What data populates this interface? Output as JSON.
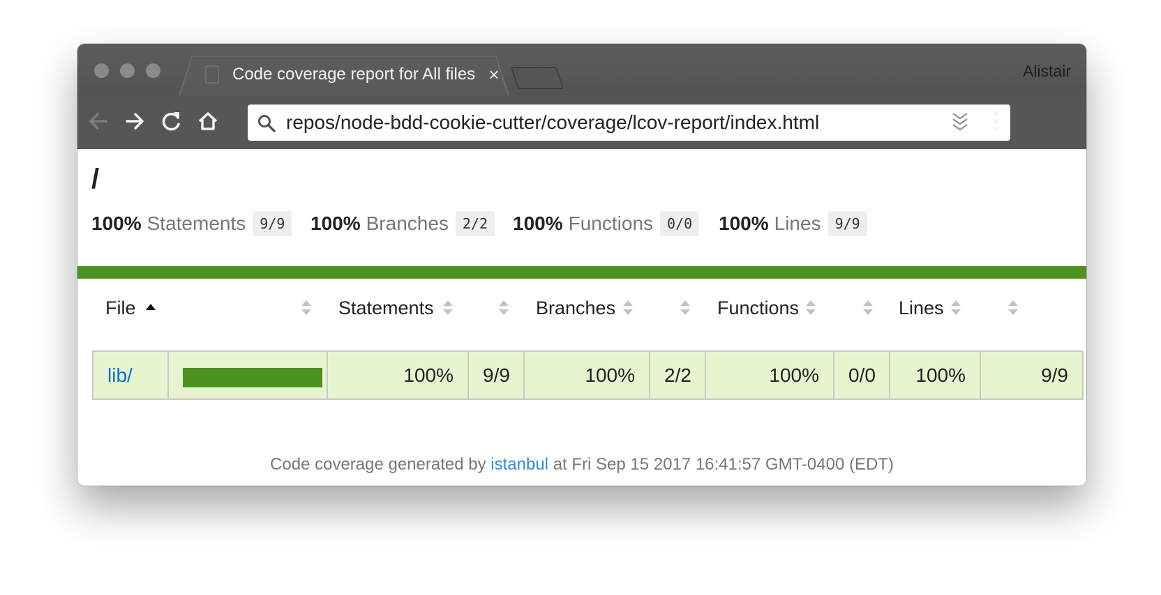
{
  "browser": {
    "tab_title": "Code coverage report for All files",
    "tab_close": "×",
    "profile_name": "Alistair",
    "url": "repos/node-bdd-cookie-cutter/coverage/lcov-report/index.html",
    "icons": {
      "back": "back-arrow-icon",
      "forward": "forward-arrow-icon",
      "reload": "reload-icon",
      "home": "home-icon",
      "search": "search-icon",
      "extension": "chevrons-down-icon",
      "menu": "kebab-menu-icon"
    }
  },
  "report": {
    "breadcrumb": "/",
    "summary": [
      {
        "pct": "100%",
        "label": "Statements",
        "fraction": "9/9"
      },
      {
        "pct": "100%",
        "label": "Branches",
        "fraction": "2/2"
      },
      {
        "pct": "100%",
        "label": "Functions",
        "fraction": "0/0"
      },
      {
        "pct": "100%",
        "label": "Lines",
        "fraction": "9/9"
      }
    ],
    "columns": [
      "File",
      "Statements",
      "Branches",
      "Functions",
      "Lines"
    ],
    "rows": [
      {
        "file": "lib/",
        "coverage_fraction": 1.0,
        "statements_pct": "100%",
        "statements_frac": "9/9",
        "branches_pct": "100%",
        "branches_frac": "2/2",
        "functions_pct": "100%",
        "functions_frac": "0/0",
        "lines_pct": "100%",
        "lines_frac": "9/9"
      }
    ],
    "footer": {
      "prefix": "Code coverage generated by",
      "link": "istanbul",
      "suffix": "at Fri Sep 15 2017 16:41:57 GMT-0400 (EDT)"
    },
    "colors": {
      "high_coverage": "#4d9221",
      "row_background": "#e6f5d0",
      "link": "#0b6fc7"
    }
  }
}
